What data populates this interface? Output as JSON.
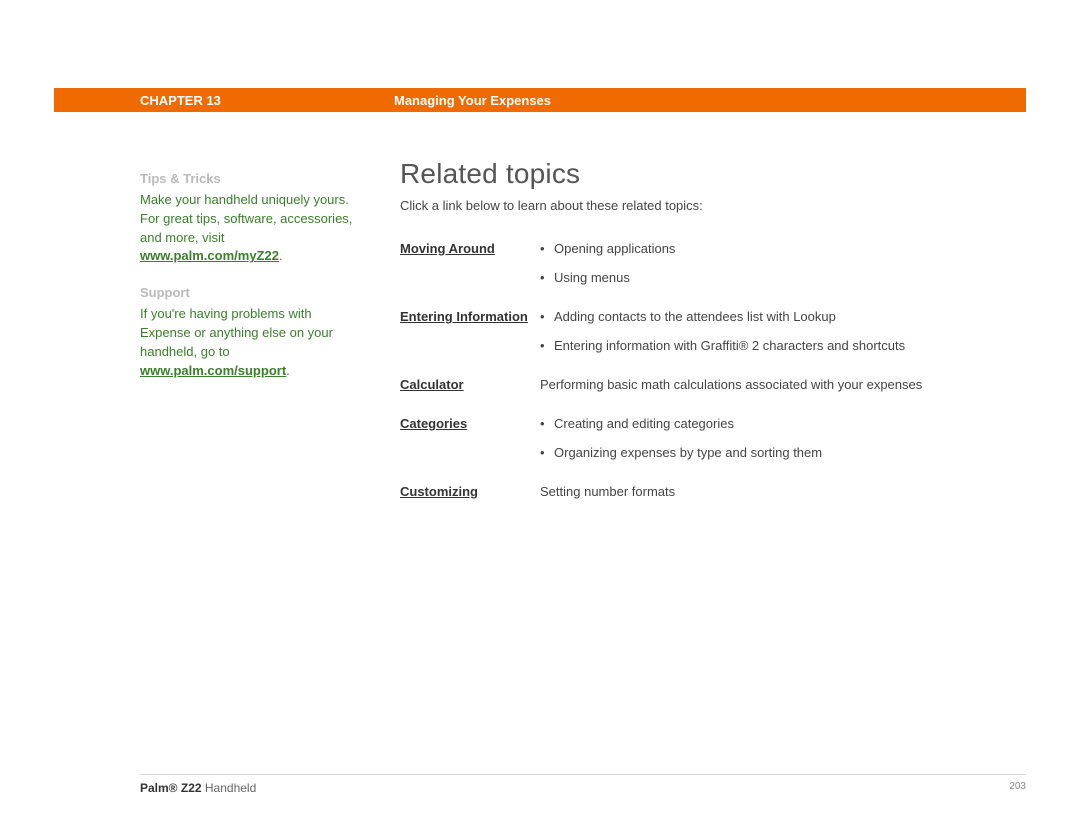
{
  "header": {
    "chapter": "CHAPTER 13",
    "title": "Managing Your Expenses"
  },
  "sidebar": {
    "tips": {
      "heading": "Tips & Tricks",
      "text_before": "Make your handheld uniquely yours. For great tips, software, accessories, and more, visit ",
      "link": "www.palm.com/myZ22",
      "text_after": "."
    },
    "support": {
      "heading": "Support",
      "text_before": "If you're having problems with Expense or anything else on your handheld, go to ",
      "link": "www.palm.com/support",
      "text_after": "."
    }
  },
  "main": {
    "heading": "Related topics",
    "intro": "Click a link below to learn about these related topics:",
    "topics": [
      {
        "label": "Moving Around",
        "bullets": [
          "Opening applications",
          "Using menus"
        ]
      },
      {
        "label": "Entering Information",
        "bullets": [
          "Adding contacts to the attendees list with Lookup",
          "Entering information with Graffiti® 2 characters and shortcuts"
        ]
      },
      {
        "label": "Calculator",
        "plain": "Performing basic math calculations associated with your expenses"
      },
      {
        "label": "Categories",
        "bullets": [
          "Creating and editing categories",
          "Organizing expenses by type and sorting them"
        ]
      },
      {
        "label": "Customizing",
        "plain": "Setting number formats"
      }
    ]
  },
  "footer": {
    "product_bold": "Palm® Z22",
    "product_rest": " Handheld",
    "page": "203"
  }
}
